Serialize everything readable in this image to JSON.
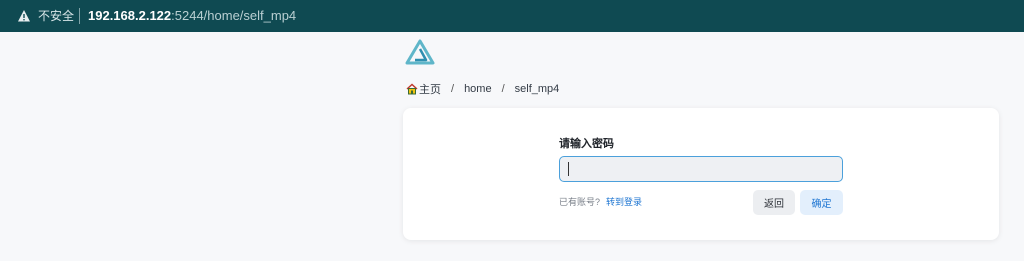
{
  "browser": {
    "security_label": "不安全",
    "url_host": "192.168.2.122",
    "url_rest": ":5244/home/self_mp4"
  },
  "app": {
    "logo_icon": "alist-logo-icon",
    "accent_color": "#1f76d2"
  },
  "breadcrumb": {
    "home_label": "主页",
    "separator": "/",
    "items": [
      "home",
      "self_mp4"
    ]
  },
  "password_dialog": {
    "prompt": "请输入密码",
    "input_value": "",
    "has_account_text": "已有账号?",
    "login_link": "转到登录",
    "back_label": "返回",
    "confirm_label": "确定"
  }
}
